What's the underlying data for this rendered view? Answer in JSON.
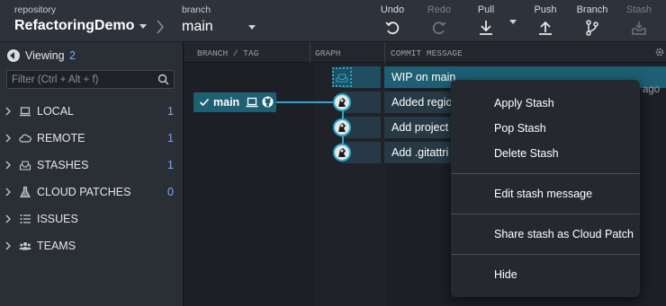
{
  "toolbar": {
    "repo_label": "repository",
    "repo_name": "RefactoringDemo",
    "branch_label": "branch",
    "branch_name": "main",
    "buttons": {
      "undo": "Undo",
      "redo": "Redo",
      "pull": "Pull",
      "push": "Push",
      "branch": "Branch",
      "stash": "Stash"
    }
  },
  "sidebar": {
    "viewing_label": "Viewing",
    "viewing_count": "2",
    "filter_placeholder": "Filter (Ctrl + Alt + f)",
    "sections": [
      {
        "label": "LOCAL",
        "count": "1",
        "icon": "laptop-icon"
      },
      {
        "label": "REMOTE",
        "count": "1",
        "icon": "cloud-icon"
      },
      {
        "label": "STASHES",
        "count": "1",
        "icon": "stash-icon"
      },
      {
        "label": "CLOUD PATCHES",
        "count": "0",
        "icon": "flask-icon"
      },
      {
        "label": "ISSUES",
        "count": "",
        "icon": "list-icon"
      },
      {
        "label": "TEAMS",
        "count": "",
        "icon": "people-icon"
      }
    ]
  },
  "graph": {
    "columns": {
      "branch_tag": "BRANCH / TAG",
      "graph": "GRAPH",
      "commit_message": "COMMIT MESSAGE"
    },
    "branch_tag": {
      "name": "main"
    },
    "time_ago": "s ago",
    "rows": [
      {
        "message": "WIP on main",
        "kind": "stash"
      },
      {
        "message": "Added regio",
        "kind": "commit"
      },
      {
        "message": "Add project",
        "kind": "commit"
      },
      {
        "message": "Add .gitattri",
        "kind": "commit"
      }
    ]
  },
  "context_menu": {
    "apply": "Apply Stash",
    "pop": "Pop Stash",
    "delete": "Delete Stash",
    "edit": "Edit stash message",
    "share": "Share stash as Cloud Patch",
    "hide": "Hide"
  },
  "colors": {
    "accent": "#2aa7c9",
    "count": "#7aa8ff",
    "wip_row": "#1e5f74"
  }
}
